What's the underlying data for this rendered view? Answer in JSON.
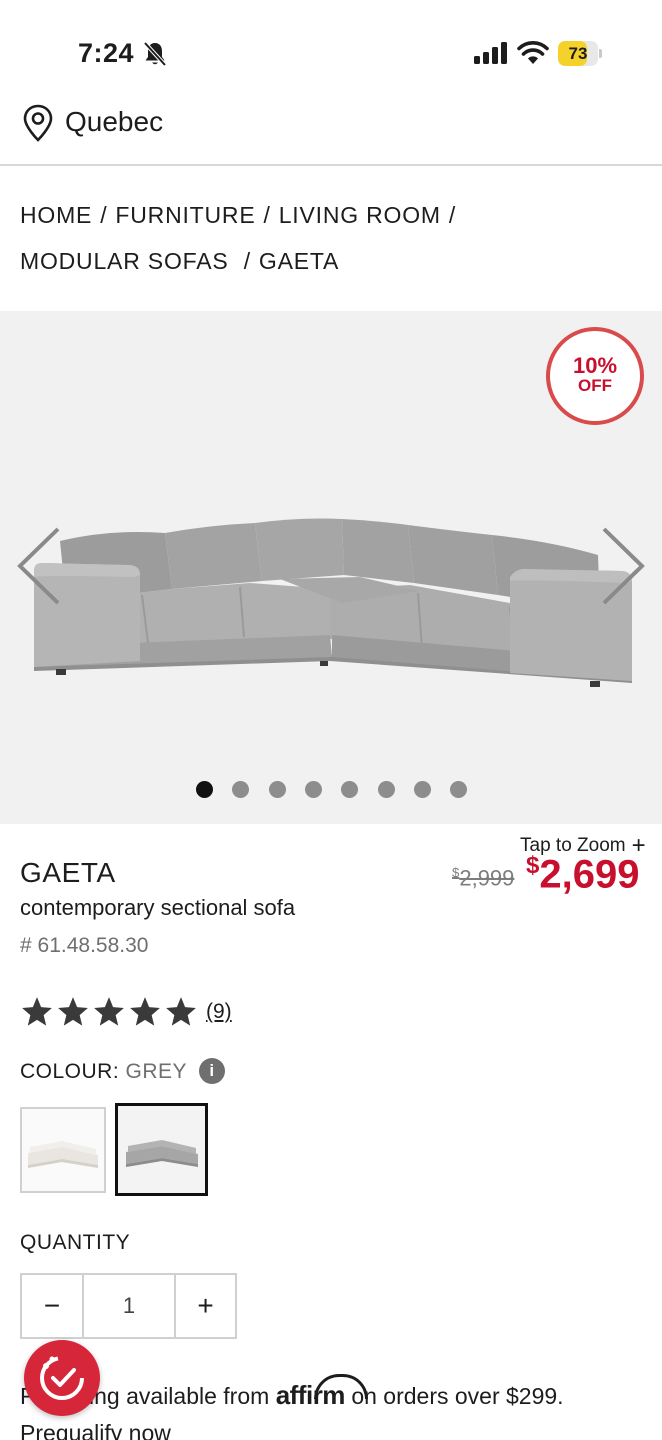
{
  "status_bar": {
    "time": "7:24",
    "battery_level": "73",
    "battery_fraction": 0.73
  },
  "location": {
    "label": "Quebec",
    "icon": "map-pin-icon"
  },
  "breadcrumb": {
    "items": [
      "HOME",
      "FURNITURE",
      "LIVING ROOM",
      "MODULAR SOFAS",
      "GAETA"
    ],
    "separator": "/"
  },
  "gallery": {
    "badge_line1": "10%",
    "badge_line2": "OFF",
    "image_count": 8,
    "active_index": 0
  },
  "product": {
    "tap_to_zoom": "Tap to Zoom",
    "name": "GAETA",
    "description": "contemporary sectional sofa",
    "sku": "# 61.48.58.30",
    "price_old_symbol": "$",
    "price_old": "2,999",
    "price_new_symbol": "$",
    "price_new": "2,699"
  },
  "rating": {
    "stars": 5,
    "review_count": "(9)"
  },
  "colour": {
    "label": "COLOUR:",
    "value": "GREY",
    "swatches": [
      "white",
      "grey"
    ],
    "selected": "grey"
  },
  "quantity": {
    "label": "QUANTITY",
    "value": "1",
    "minus": "−",
    "plus": "+"
  },
  "financing": {
    "prefix": "Financing available from",
    "brand": "affirm",
    "suffix": "on orders over $299.",
    "prequalify": "Prequalify now"
  },
  "colors": {
    "accent_red": "#c8102e",
    "badge_border": "#d94b4b",
    "gallery_bg": "#f1f1f1",
    "battery_yellow": "#f5d22b"
  }
}
